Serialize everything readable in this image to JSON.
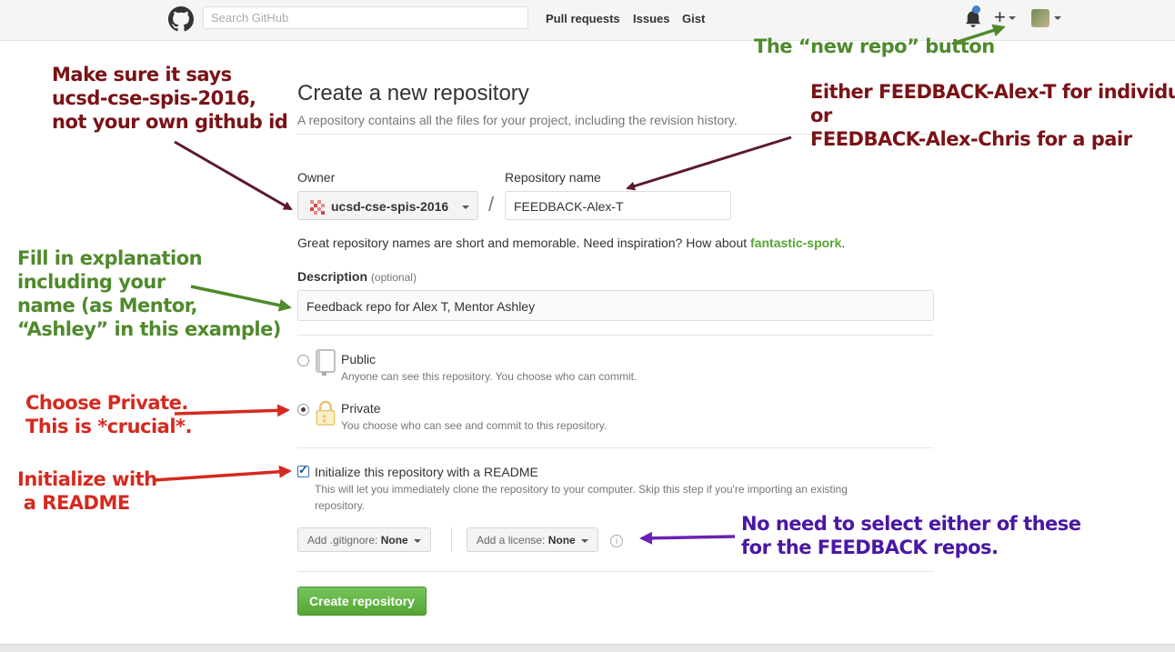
{
  "header": {
    "search_placeholder": "Search GitHub",
    "nav": [
      "Pull requests",
      "Issues",
      "Gist"
    ],
    "icons": [
      "github-logo-icon",
      "bell-icon",
      "plus-icon",
      "avatar"
    ]
  },
  "form": {
    "title": "Create a new repository",
    "subtitle": "A repository contains all the files for your project, including the revision history.",
    "owner_label": "Owner",
    "owner_value": "ucsd-cse-spis-2016",
    "repo_label": "Repository name",
    "repo_value": "FEEDBACK-Alex-T",
    "slash": "/",
    "hint_text": "Great repository names are short and memorable. Need inspiration? How about",
    "hint_suggestion": "fantastic-spork",
    "hint_period": ".",
    "desc_label": "Description",
    "desc_optional": "(optional)",
    "desc_value": "Feedback repo for Alex T, Mentor Ashley",
    "public_title": "Public",
    "public_desc": "Anyone can see this repository. You choose who can commit.",
    "private_title": "Private",
    "private_desc": "You choose who can see and commit to this repository.",
    "visibility_selected": "Private",
    "readme_label": "Initialize this repository with a README",
    "readme_desc_1": "This will let you immediately clone the repository to your computer. Skip this step if you're importing an existing",
    "readme_desc_2": "repository.",
    "readme_checked": true,
    "gitignore_prefix": "Add .gitignore:",
    "gitignore_value": "None",
    "license_prefix": "Add a license:",
    "license_value": "None",
    "create_button": "Create repository"
  },
  "annotations": {
    "owner_note": "Make sure it says\nucsd-cse-spis-2016,\nnot your own github id",
    "repo_note": "Either FEEDBACK-Alex-T for individual\nor\nFEEDBACK-Alex-Chris for a pair",
    "new_repo_note": "The “new repo” button",
    "desc_note": "Fill in explanation\nincluding your\nname (as Mentor,\n“Ashley” in this example)",
    "private_note": "Choose Private.\nThis is *crucial*.",
    "readme_note": "Initialize with\n a README",
    "select_note": "No need to select either of these\nfor the FEEDBACK repos.",
    "colors": {
      "red": "#d42a20",
      "maroon": "#7a1216",
      "green": "#4f8a2c",
      "purple": "#4a17a3"
    }
  }
}
